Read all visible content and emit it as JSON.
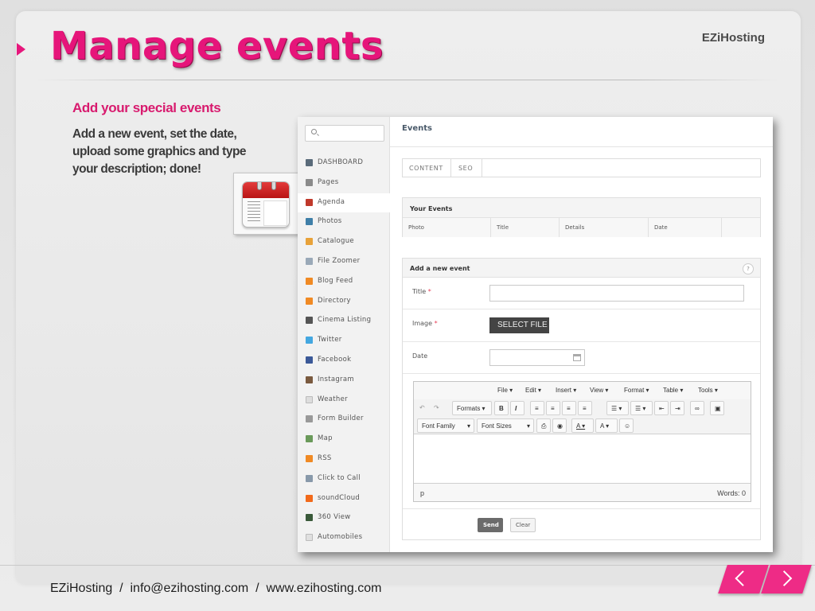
{
  "slide": {
    "title": "Manage events",
    "brand": "EZiHosting",
    "subtitle": "Add your special events",
    "description": "Add a new event, set the date, upload some graphics and type your description; done!",
    "footer": {
      "company": "EZiHosting",
      "separator": "  /  ",
      "email": "info@ezihosting.com",
      "website": "www.ezihosting.com"
    },
    "nav": {
      "prev_icon": "chevron-left-icon",
      "next_icon": "chevron-right-icon",
      "prev_label": "<",
      "next_label": ">"
    },
    "colors": {
      "accent": "#e6157a",
      "nav": "#ee2b86"
    }
  },
  "app": {
    "search_icon": "search-icon",
    "sidebar": {
      "items": [
        {
          "label": "DASHBOARD",
          "icon": "monitor-icon",
          "color": "#5a6b7a"
        },
        {
          "label": "Pages",
          "icon": "pages-icon",
          "color": "#8a8a8a"
        },
        {
          "label": "Agenda",
          "icon": "calendar-icon",
          "color": "#c0392b",
          "active": true
        },
        {
          "label": "Photos",
          "icon": "photo-icon",
          "color": "#3f7fa8"
        },
        {
          "label": "Catalogue",
          "icon": "catalogue-icon",
          "color": "#e8a23a"
        },
        {
          "label": "File Zoomer",
          "icon": "magnifier-icon",
          "color": "#9aa9b8"
        },
        {
          "label": "Blog Feed",
          "icon": "rss-icon",
          "color": "#f08a24"
        },
        {
          "label": "Directory",
          "icon": "rss-icon",
          "color": "#f08a24"
        },
        {
          "label": "Cinema Listing",
          "icon": "film-icon",
          "color": "#555555"
        },
        {
          "label": "Twitter",
          "icon": "twitter-icon",
          "color": "#44a7e0"
        },
        {
          "label": "Facebook",
          "icon": "facebook-icon",
          "color": "#3b5998"
        },
        {
          "label": "Instagram",
          "icon": "instagram-icon",
          "color": "#7a5a3f"
        },
        {
          "label": "Weather",
          "icon": "weather-icon",
          "color": "#dddddd"
        },
        {
          "label": "Form Builder",
          "icon": "form-icon",
          "color": "#999999"
        },
        {
          "label": "Map",
          "icon": "map-icon",
          "color": "#6a9a5a"
        },
        {
          "label": "RSS",
          "icon": "rss-icon",
          "color": "#f08a24"
        },
        {
          "label": "Click to Call",
          "icon": "phone-icon",
          "color": "#8899aa"
        },
        {
          "label": "soundCloud",
          "icon": "soundcloud-icon",
          "color": "#f26a1b"
        },
        {
          "label": "360 View",
          "icon": "panorama-icon",
          "color": "#3a5a3a"
        },
        {
          "label": "Automobiles",
          "icon": "car-icon",
          "color": "#e0e0e0"
        }
      ]
    },
    "main": {
      "title": "Events",
      "tabs": [
        "CONTENT",
        "SEO"
      ],
      "events_table": {
        "heading": "Your Events",
        "columns": [
          "Photo",
          "Title",
          "Details",
          "Date"
        ]
      },
      "add_form": {
        "heading": "Add a new event",
        "help_label": "?",
        "title_label": "Title",
        "title_value": "",
        "image_label": "Image",
        "select_file_label": "SELECT FILE",
        "date_label": "Date",
        "date_value": "",
        "required_mark": "*"
      },
      "editor": {
        "menus": [
          "File ▾",
          "Edit ▾",
          "Insert ▾",
          "View ▾",
          "Format ▾",
          "Table ▾",
          "Tools ▾"
        ],
        "formats_label": "Formats ▾",
        "font_family_label": "Font Family",
        "font_sizes_label": "Font Sizes",
        "status_path": "p",
        "word_count": "Words: 0"
      },
      "send_label": "Send",
      "clear_label": "Clear"
    }
  }
}
